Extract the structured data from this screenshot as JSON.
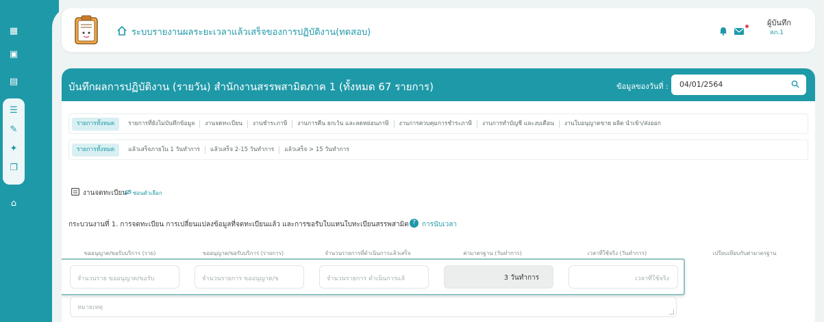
{
  "header": {
    "app_title": "ระบบรายงานผลระยะเวลาแล้วเสร็จของการปฏิบัติงาน(ทดสอบ)",
    "user_name": "ผู้บันทึก",
    "user_role": "สภ.1"
  },
  "band": {
    "title": "บันทึกผลการปฏิบัติงาน (รายวัน) สำนักงานสรรพสามิตภาค 1 (ทั้งหมด 67 รายการ)",
    "date_label": "ข้อมูลของวันที่ :",
    "date_value": "04/01/2564"
  },
  "tabs_primary": [
    "รายการทั้งหมด",
    "รายการที่ยังไม่บันทึกข้อมูล",
    "งานจดทะเบียน",
    "งานชำระภาษี",
    "งานการคืน ยกเว้น และลดหย่อนภาษี",
    "งานการควบคุมการชำระภาษี",
    "งานการทำบัญชี และงบเดือน",
    "งานใบอนุญาตขาย ผลิต นำเข้า/ส่งออก"
  ],
  "tabs_secondary": [
    "รายการทั้งหมด",
    "แล้วเสร็จภายใน 1 วันทำการ",
    "แล้วเสร็จ 2-15 วันทำการ",
    "แล้วเสร็จ > 15 วันทำการ"
  ],
  "section": {
    "title": "งานจดทะเบียน",
    "hide_label": "ซ่อนตัวเลือก"
  },
  "process": {
    "text": "กระบวนงานที่ 1. การจดทะเบียน การเปลี่ยนแปลงข้อมูลที่จดทะเบียนแล้ว และการขอรับใบแทนใบทะเบียนสรรพสามิต",
    "link": "การนับเวลา"
  },
  "columns": [
    "ขออนุญาต/ขอรับบริการ (ราย)",
    "ขออนุญาต/ขอรับบริการ (รายการ)",
    "จำนวนรายการที่ดำเนินการแล้วเสร็จ",
    "ค่ามาตรฐาน (วันทำการ)",
    "เวลาที่ใช้จริง (วันทำการ)",
    "เปรียบเทียบกับค่ามาตรฐาน"
  ],
  "fields": {
    "ph_1": "จำนวนราย ขออนุญาต/ขอรับ",
    "ph_2": "จำนวนรายการ ขออนุญาต/ข",
    "ph_3": "จำนวนรายการ ดำเนินการแล้",
    "standard_value": "3 วันทำการ",
    "ph_5": "เวลาที่ใช้จริง",
    "note_ph": "หมายเหตุ"
  },
  "colors": {
    "accent": "#1e99a8",
    "background": "#eef3f3",
    "alert": "#e0465d"
  }
}
